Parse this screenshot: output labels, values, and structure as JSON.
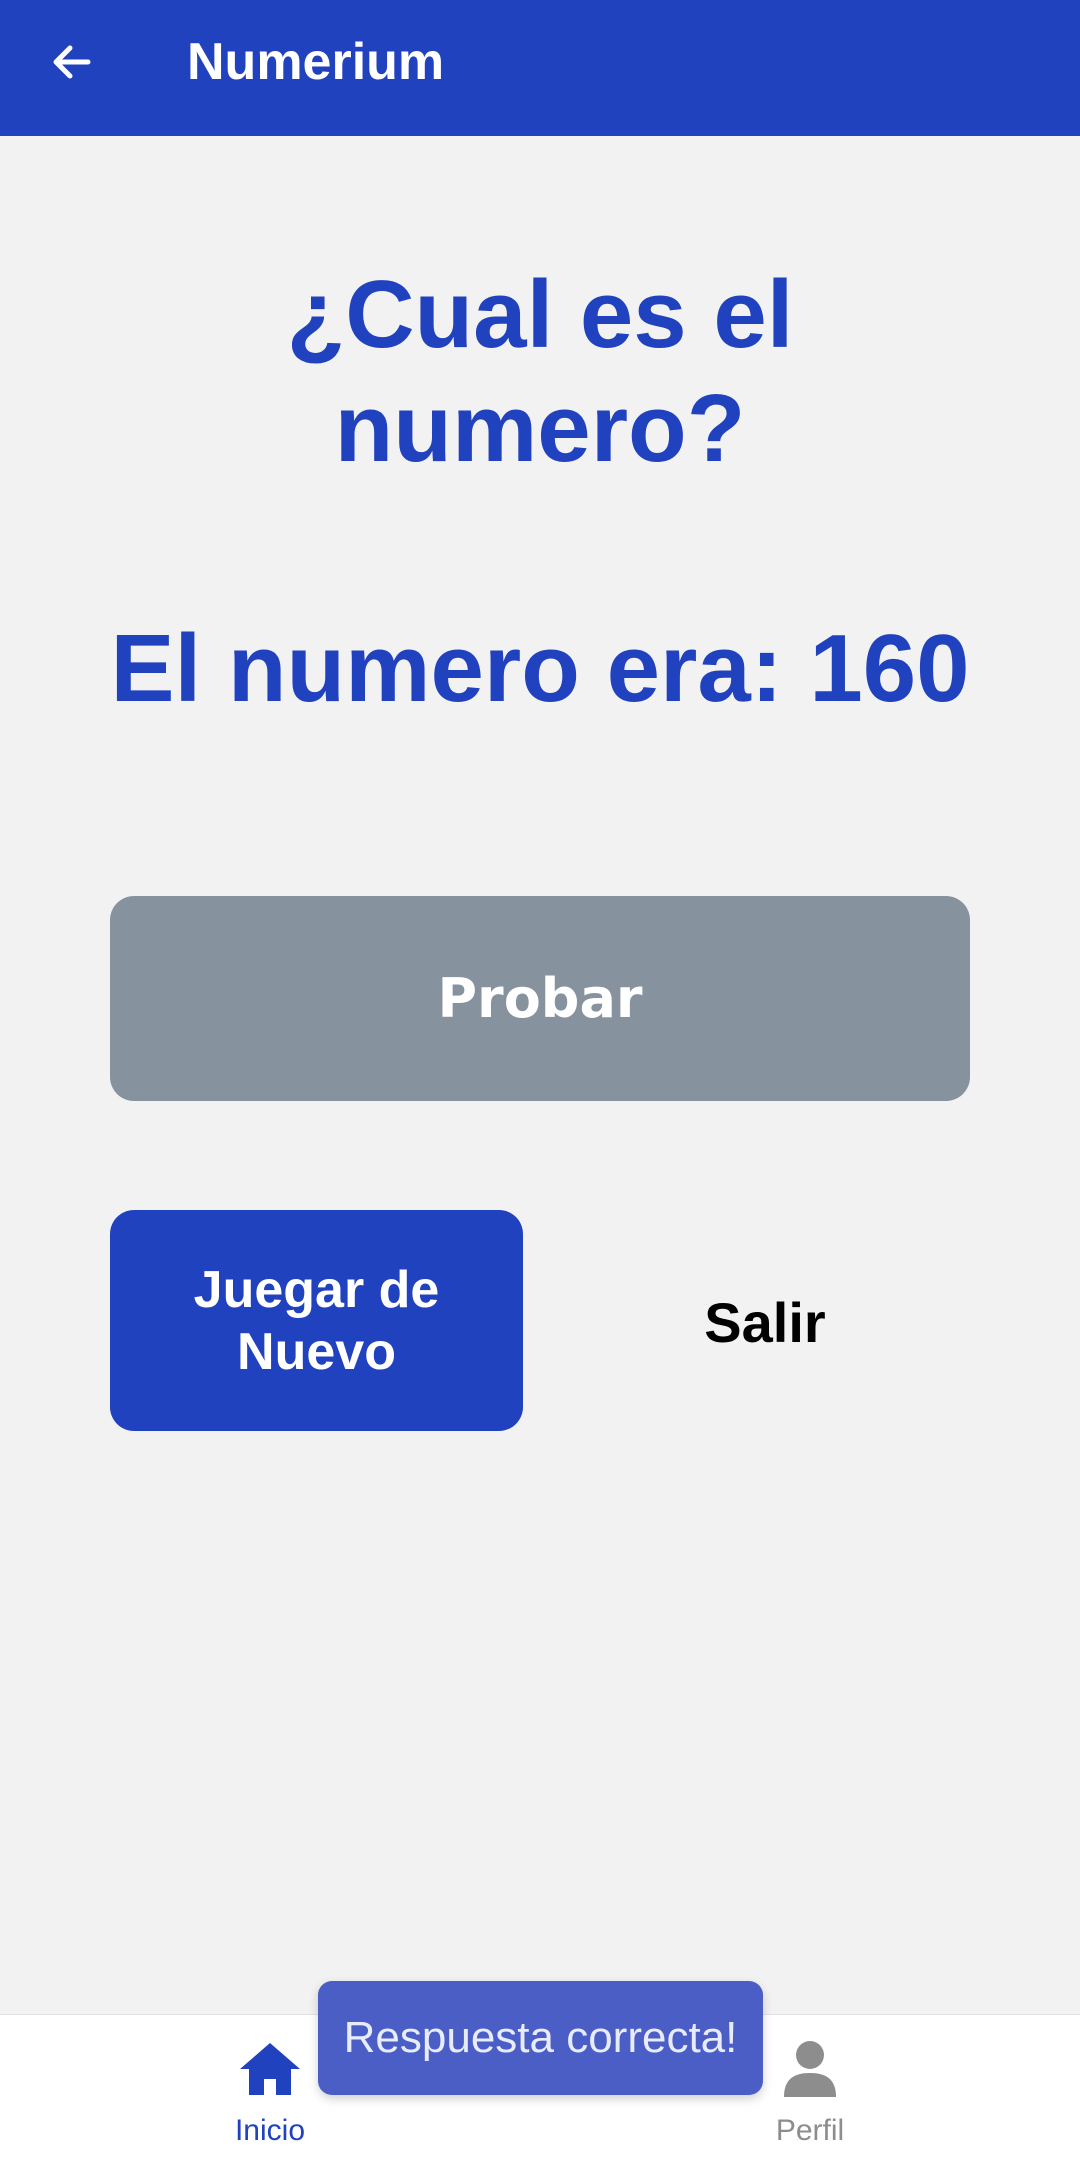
{
  "app_bar": {
    "title": "Numerium",
    "back_icon": "arrow-left-icon"
  },
  "game": {
    "question": "¿Cual es el numero?",
    "result": "El numero era: 160",
    "try_button": "Probar",
    "play_again_button": "Juegar de Nuevo",
    "exit_button": "Salir"
  },
  "bottom_nav": {
    "items": [
      {
        "label": "Inicio",
        "icon": "home-icon",
        "active": true
      },
      {
        "label": "Perfil",
        "icon": "person-icon",
        "active": false
      }
    ]
  },
  "toast": {
    "message": "Respuesta correcta!"
  },
  "colors": {
    "primary": "#2142be",
    "disabled_button": "#86929e",
    "background": "#f2f2f2",
    "toast": "#4a5ec6",
    "inactive_nav": "#8d8d8d"
  }
}
